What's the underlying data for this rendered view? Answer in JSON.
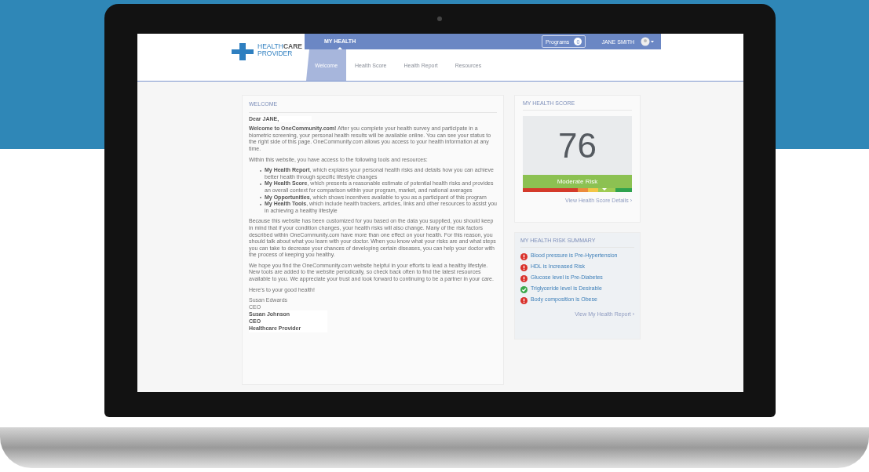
{
  "logo": {
    "line1": "HEALTH**CARE**",
    "line2": "PROVIDER"
  },
  "top_nav": {
    "items": [
      {
        "label": "MY HEALTH",
        "selected": true
      }
    ],
    "programs": {
      "label": "Programs",
      "badge": "0"
    },
    "user": "JANE SMITH"
  },
  "tabs": [
    {
      "label": "Welcome",
      "selected": true
    },
    {
      "label": "Health Score",
      "selected": false
    },
    {
      "label": "Health Report",
      "selected": false
    },
    {
      "label": "Resources",
      "selected": false
    }
  ],
  "welcome": {
    "title": "WELCOME",
    "greeting": "Dear JANE,",
    "intro": "**Welcome to OneCommunity.com!** After you complete your health survey and participate in a biometric screening, your personal health results will be available online. You can see your status to the right side of this page. OneCommunity.com allows you access to your health information at any time.",
    "tools_intro": "Within this website, you have access to the following tools and resources:",
    "bullets": [
      "**My Health Report**, which explains your personal health risks and details how you can achieve better health through specific lifestyle changes",
      "**My Health Score**, which presents a reasonable estimate of potential health risks and provides an overall context for comparison within your program, market, and national averages",
      "**My Opportunities**, which shows incentives available to you as a participant of this program",
      "**My Health Tools**, which include health trackers, articles, links and other resources to assist you in achieving a healthy lifestyle"
    ],
    "paragraphs": [
      "Because this website has been customized for you based on the data you supplied, you should keep in mind that if your condition changes, your health risks will also change. Many of the risk factors described within OneCommunity.com have more than one effect on your health. For this reason, you should talk about what you learn with your doctor. When you know what your risks are and what steps you can take to decrease your chances of developing certain diseases, you can help your doctor with the process of keeping you healthy.",
      "We hope you find the OneCommunity.com website helpful in your efforts to lead a healthy lifestyle. New tools are added to the website periodically, so check back often to find the latest resources available to you. We appreciate your trust and look forward to continuing to be a partner in your care.",
      "Here's to your good health!"
    ],
    "signature": [
      "Susan Edwards",
      "CEO"
    ],
    "signature_box": [
      "Susan Johnson",
      "CEO",
      "Healthcare Provider"
    ]
  },
  "score": {
    "title": "MY HEALTH SCORE",
    "value": "76",
    "risk": "Moderate Risk",
    "link": "View Health Score Details ›"
  },
  "risk_summary": {
    "title": "MY HEALTH RISK SUMMARY",
    "items": [
      {
        "kind": "warning",
        "text": "Blood pressure is Pre-Hypertension"
      },
      {
        "kind": "warning",
        "text": "HDL is Increased Risk"
      },
      {
        "kind": "warning",
        "text": "Glucose level is Pre-Diabetes"
      },
      {
        "kind": "ok",
        "text": "Triglyceride level is Desirable"
      },
      {
        "kind": "warning",
        "text": "Body composition is Obese"
      }
    ],
    "link": "View My Health Report ›"
  }
}
